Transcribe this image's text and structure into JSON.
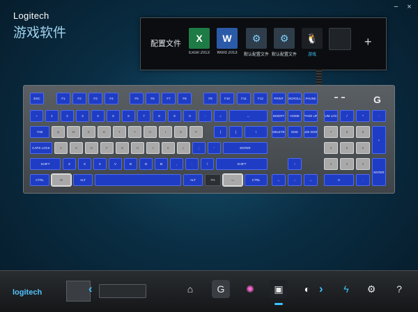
{
  "header": {
    "brand": "Logitech",
    "app_title": "游戏软件"
  },
  "window_controls": {
    "minimize": "−",
    "close": "×"
  },
  "profiles": {
    "label": "配置文件",
    "items": [
      {
        "name": "Excel 2013",
        "glyph": "X",
        "icon": "excel-icon"
      },
      {
        "name": "Word 2013",
        "glyph": "W",
        "icon": "word-icon"
      },
      {
        "name": "默认配置文件",
        "glyph": "⚙",
        "icon": "gear-icon"
      },
      {
        "name": "默认配置文件",
        "glyph": "⚙",
        "icon": "gear-icon"
      },
      {
        "name": "游戏",
        "glyph": "🐧",
        "icon": "penguin-icon",
        "active": true
      },
      {
        "name": "",
        "glyph": "",
        "icon": "empty-slot"
      }
    ],
    "add": "+"
  },
  "keyboard": {
    "logo": "G",
    "keys": {
      "esc": "ESC",
      "f1": "F1",
      "f2": "F2",
      "f3": "F3",
      "f4": "F4",
      "f5": "F5",
      "f6": "F6",
      "f7": "F7",
      "f8": "F8",
      "f9": "F9",
      "f10": "F10",
      "f11": "F11",
      "f12": "F12",
      "prtsc": "PRINT",
      "scroll": "SCROLL",
      "pause": "PAUSE",
      "tilde": "~",
      "n1": "1",
      "n2": "2",
      "n3": "3",
      "n4": "4",
      "n5": "5",
      "n6": "6",
      "n7": "7",
      "n8": "8",
      "n9": "9",
      "n0": "0",
      "minus": "-",
      "equal": "=",
      "backspace": "←",
      "insert": "INSERT",
      "home": "HOME",
      "pgup": "PAGE UP",
      "numlock": "NUM LOCK",
      "numdiv": "/",
      "nummul": "*",
      "numsub": "-",
      "tab": "TAB",
      "q": "Q",
      "w": "W",
      "e": "E",
      "r": "R",
      "t": "T",
      "y": "Y",
      "u": "U",
      "i": "I",
      "o": "O",
      "p": "P",
      "lbr": "[",
      "rbr": "]",
      "bslash": "\\",
      "delete": "DELETE",
      "end": "END",
      "pgdn": "PAGE DOWN",
      "num7": "7",
      "num8": "8",
      "num9": "9",
      "numadd": "+",
      "caps": "CAPS LOCK",
      "a": "A",
      "s": "S",
      "d": "D",
      "f": "F",
      "g": "G",
      "h": "H",
      "j": "J",
      "k": "K",
      "l": "L",
      "semi": ";",
      "quote": "'",
      "enter": "ENTER",
      "num4": "4",
      "num5": "5",
      "num6": "6",
      "lshift": "SHIFT",
      "z": "Z",
      "x": "X",
      "c": "C",
      "v": "V",
      "b": "B",
      "n": "N",
      "m": "M",
      "comma": ",",
      "period": ".",
      "slash": "/",
      "rshift": "SHIFT",
      "up": "↑",
      "num1": "1",
      "num2": "2",
      "num3": "3",
      "numenter": "ENTER",
      "lctrl": "CTRL",
      "win": "⊞",
      "lalt": "ALT",
      "space": "",
      "ralt": "ALT",
      "fn": "FN",
      "menu": "▭",
      "rctrl": "CTRL",
      "left": "←",
      "down": "↓",
      "right": "→",
      "num0": "0",
      "numdot": "."
    }
  },
  "bottom_bar": {
    "logo_text": "logitech",
    "prev": "‹",
    "next": "›",
    "nav": [
      "home-icon",
      "g-key-icon",
      "lighting-icon",
      "keyboard-heatmap-icon",
      "pointer-icon",
      "lightning-icon",
      "settings-gear-icon",
      "help-icon"
    ]
  }
}
